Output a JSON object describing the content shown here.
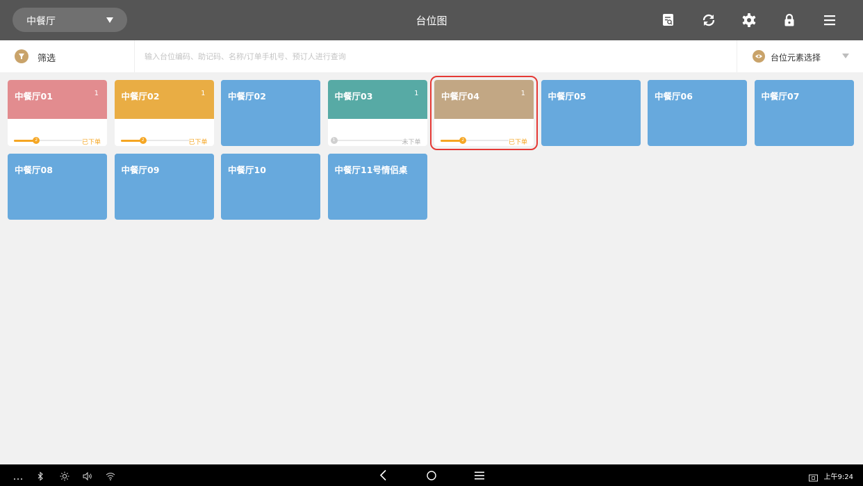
{
  "header": {
    "area_selector": "中餐厅",
    "title": "台位图",
    "icons": [
      "search-doc-icon",
      "refresh-icon",
      "gear-icon",
      "lock-icon",
      "menu-icon"
    ]
  },
  "filterbar": {
    "filter_label": "筛选",
    "search_placeholder": "输入台位编码、助记码、名称/订单手机号、预订人进行查询",
    "element_select_label": "台位元素选择"
  },
  "colors": {
    "topbar": "#555555",
    "free_table": "#67a9dd",
    "accent_gold": "#c9a36a",
    "progress": "#f5a623",
    "selection_outline": "#e53935"
  },
  "tables": [
    {
      "name": "中餐厅01",
      "state": "occupied",
      "color": "#e28c8f",
      "count": "1",
      "step": "2",
      "progress": 0.33,
      "status": "已下单",
      "selected": false
    },
    {
      "name": "中餐厅02",
      "state": "occupied",
      "color": "#e9ad44",
      "count": "1",
      "step": "2",
      "progress": 0.33,
      "status": "已下单",
      "selected": false
    },
    {
      "name": "中餐厅02",
      "state": "free",
      "color": "#67a9dd",
      "selected": false
    },
    {
      "name": "中餐厅03",
      "state": "occupied",
      "color": "#57aaa5",
      "count": "1",
      "step": "1",
      "progress": 0,
      "status": "未下单",
      "selected": false
    },
    {
      "name": "中餐厅04",
      "state": "occupied",
      "color": "#c2a784",
      "count": "1",
      "step": "2",
      "progress": 0.33,
      "status": "已下单",
      "selected": true
    },
    {
      "name": "中餐厅05",
      "state": "free",
      "color": "#67a9dd",
      "selected": false
    },
    {
      "name": "中餐厅06",
      "state": "free",
      "color": "#67a9dd",
      "selected": false
    },
    {
      "name": "中餐厅07",
      "state": "free",
      "color": "#67a9dd",
      "selected": false
    },
    {
      "name": "中餐厅08",
      "state": "free",
      "color": "#67a9dd",
      "selected": false
    },
    {
      "name": "中餐厅09",
      "state": "free",
      "color": "#67a9dd",
      "selected": false
    },
    {
      "name": "中餐厅10",
      "state": "free",
      "color": "#67a9dd",
      "selected": false
    },
    {
      "name": "中餐厅11号情侣桌",
      "state": "free",
      "color": "#67a9dd",
      "selected": false
    }
  ],
  "system_bar": {
    "left_icons": [
      "more-icon",
      "bluetooth-icon",
      "brightness-icon",
      "volume-icon",
      "wifi-icon"
    ],
    "nav_icons": [
      "back-icon",
      "home-icon",
      "recents-icon"
    ],
    "clock": "上午9:24"
  }
}
